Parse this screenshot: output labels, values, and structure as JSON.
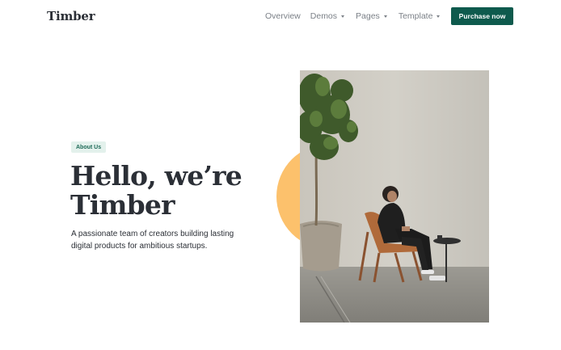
{
  "nav": {
    "logo": "Timber",
    "links": [
      {
        "label": "Overview",
        "has_dropdown": false
      },
      {
        "label": "Demos",
        "has_dropdown": true
      },
      {
        "label": "Pages",
        "has_dropdown": true
      },
      {
        "label": "Template",
        "has_dropdown": true
      }
    ],
    "cta_label": "Purchase now"
  },
  "hero": {
    "badge": "About Us",
    "title_line1": "Hello, we’re",
    "title_line2": "Timber",
    "description": "A passionate team of creators building lasting digital products for ambitious startups."
  },
  "colors": {
    "brand_green": "#0e5a4d",
    "badge_bg": "#e3f1ec",
    "badge_text": "#1d6a57",
    "accent_circle": "#fcc16c",
    "text_dark": "#2b2f36",
    "nav_text": "#7b8087"
  }
}
